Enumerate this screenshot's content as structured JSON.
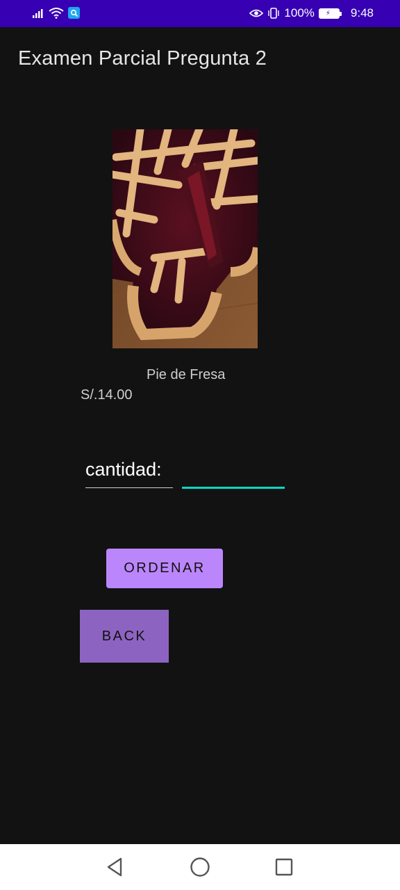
{
  "status_bar": {
    "battery_percent": "100%",
    "time": "9:48",
    "icons": [
      "signal-icon",
      "wifi-icon",
      "search-icon",
      "eye-icon",
      "vibrate-icon",
      "battery-icon"
    ]
  },
  "app": {
    "title": "Examen Parcial Pregunta 2"
  },
  "product": {
    "image_icon": "pie-image",
    "name": "Pie de Fresa",
    "price": "S/.14.00"
  },
  "quantity": {
    "label": "cantidad:",
    "value": "",
    "placeholder": ""
  },
  "buttons": {
    "order_label": "ORDENAR",
    "back_label": "BACK"
  },
  "nav_bar": {
    "icons": [
      "back-triangle-icon",
      "home-circle-icon",
      "recents-square-icon"
    ]
  },
  "colors": {
    "status_bar": "#3700b3",
    "background": "#121212",
    "accent_teal": "#03dac5",
    "button_primary": "#bb86fc",
    "button_secondary": "#8d63c2"
  }
}
